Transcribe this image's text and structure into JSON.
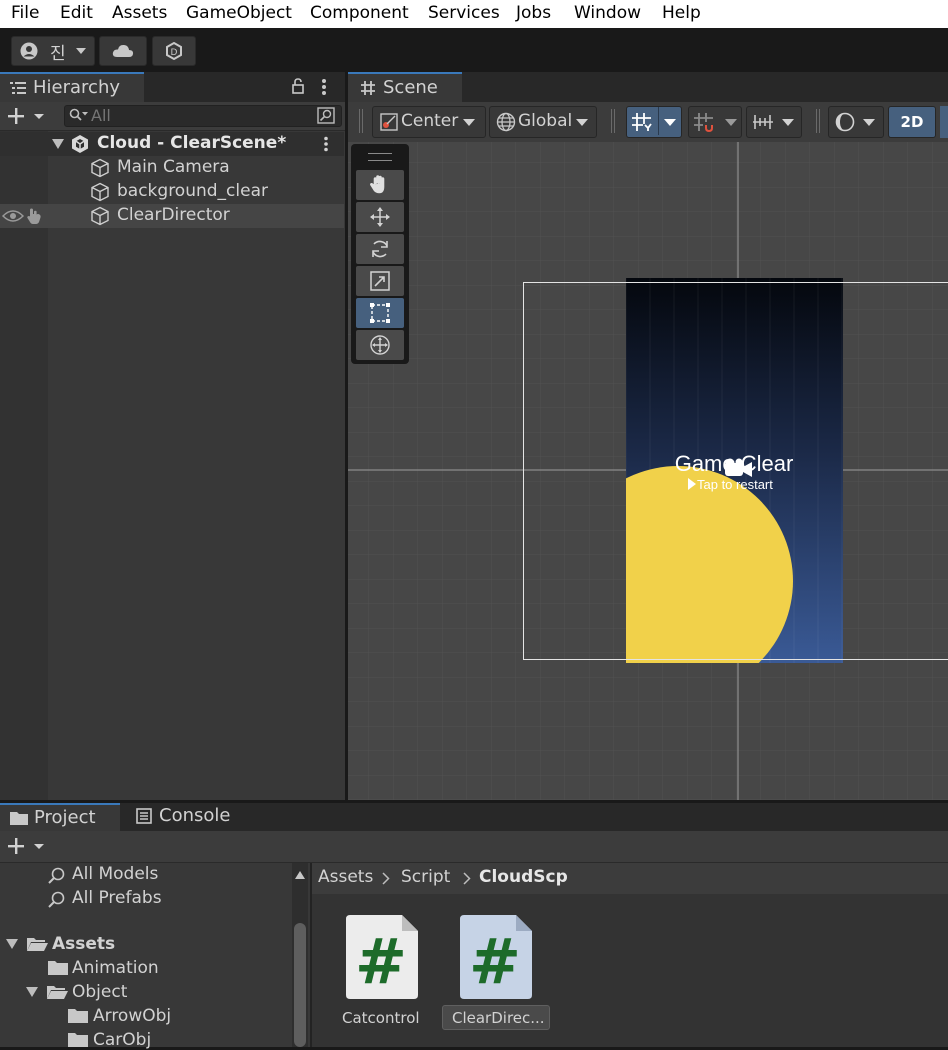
{
  "menu": [
    "File",
    "Edit",
    "Assets",
    "GameObject",
    "Component",
    "Services",
    "Jobs",
    "Window",
    "Help"
  ],
  "toolbar": {
    "account_label": "진"
  },
  "hierarchy": {
    "tab_label": "Hierarchy",
    "search_placeholder": "All",
    "scene_name": "Cloud - ClearScene*",
    "items": [
      "Main Camera",
      "background_clear",
      "ClearDirector"
    ]
  },
  "scene": {
    "tab_label": "Scene",
    "pivot_label": "Center",
    "space_label": "Global",
    "mode_2d_label": "2D",
    "game_title": "Game Clear",
    "game_subtitle": "Tap to restart",
    "colors": {
      "sky_top": "#04070d",
      "sky_bottom": "#3a5a96",
      "sun": "#f1d14a",
      "grid_bg": "#474747"
    }
  },
  "bottom": {
    "tabs": [
      "Project",
      "Console"
    ],
    "favorites": [
      "All Models",
      "All Prefabs"
    ],
    "tree": {
      "assets": "Assets",
      "animation": "Animation",
      "object": "Object",
      "arrowobj": "ArrowObj",
      "carobj": "CarObj"
    },
    "breadcrumb": [
      "Assets",
      "Script",
      "CloudScp"
    ],
    "files": [
      "Catcontrol",
      "ClearDirec..."
    ]
  }
}
